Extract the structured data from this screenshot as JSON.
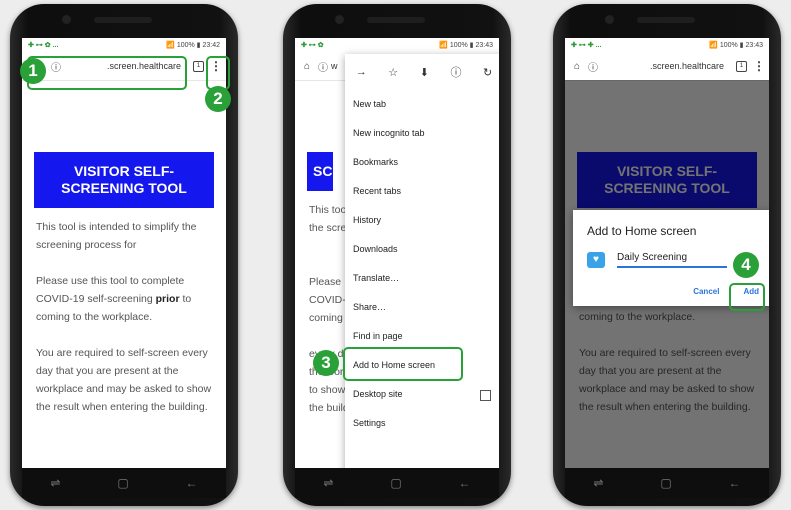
{
  "colors": {
    "accent_green": "#2aa038",
    "banner_blue": "#1418ee",
    "link_blue": "#2b74d9"
  },
  "status_bar": {
    "p1": {
      "left": "✚ ⊶ ✿ ...",
      "right": "📶 100% ▮ 23:42"
    },
    "p2": {
      "left": "✚ ⊶ ✿",
      "right": "📶 100% ▮ 23:43"
    },
    "p3": {
      "left": "✚ ⊶ ✚ ...",
      "right": "📶 100% ▮ 23:43"
    }
  },
  "toolbar": {
    "url": ".screen.healthcare",
    "url_short": "w",
    "tab_count": "1",
    "info_icon": "ⓘ",
    "menu_icon": "⋮",
    "home_icon": "⌂"
  },
  "page": {
    "banner": "VISITOR SELF-SCREENING TOOL",
    "para1": "This tool is intended to simplify the screening process for",
    "para2_a": "Please use this tool to complete COVID-19 self-screening ",
    "para2_b": "prior",
    "para2_c": " to coming to the workplace.",
    "para3": "You are required to self-screen every day that you are present at the workplace and may be asked to show the result when entering the building."
  },
  "partial_text": {
    "banner": "SC",
    "l1": "This too",
    "l2": "the scre",
    "l3": "Please",
    "l4": "COVID-",
    "l5": "coming",
    "l6": "every d",
    "l7": "the wor",
    "l8": "to show",
    "l9": "the building"
  },
  "menu": {
    "icons": [
      "→",
      "☆",
      "⬇",
      "ⓘ",
      "↻"
    ],
    "items": [
      "New tab",
      "New incognito tab",
      "Bookmarks",
      "Recent tabs",
      "History",
      "Downloads",
      "Translate…",
      "Share…",
      "Find in page",
      "Add to Home screen",
      "Desktop site",
      "Settings"
    ]
  },
  "dialog": {
    "title": "Add to Home screen",
    "name_value": "Daily Screening",
    "cancel": "Cancel",
    "add": "Add"
  },
  "steps": [
    "1",
    "2",
    "3",
    "4"
  ],
  "nav": {
    "recent": "⇌",
    "home": "▢",
    "back": "←"
  }
}
